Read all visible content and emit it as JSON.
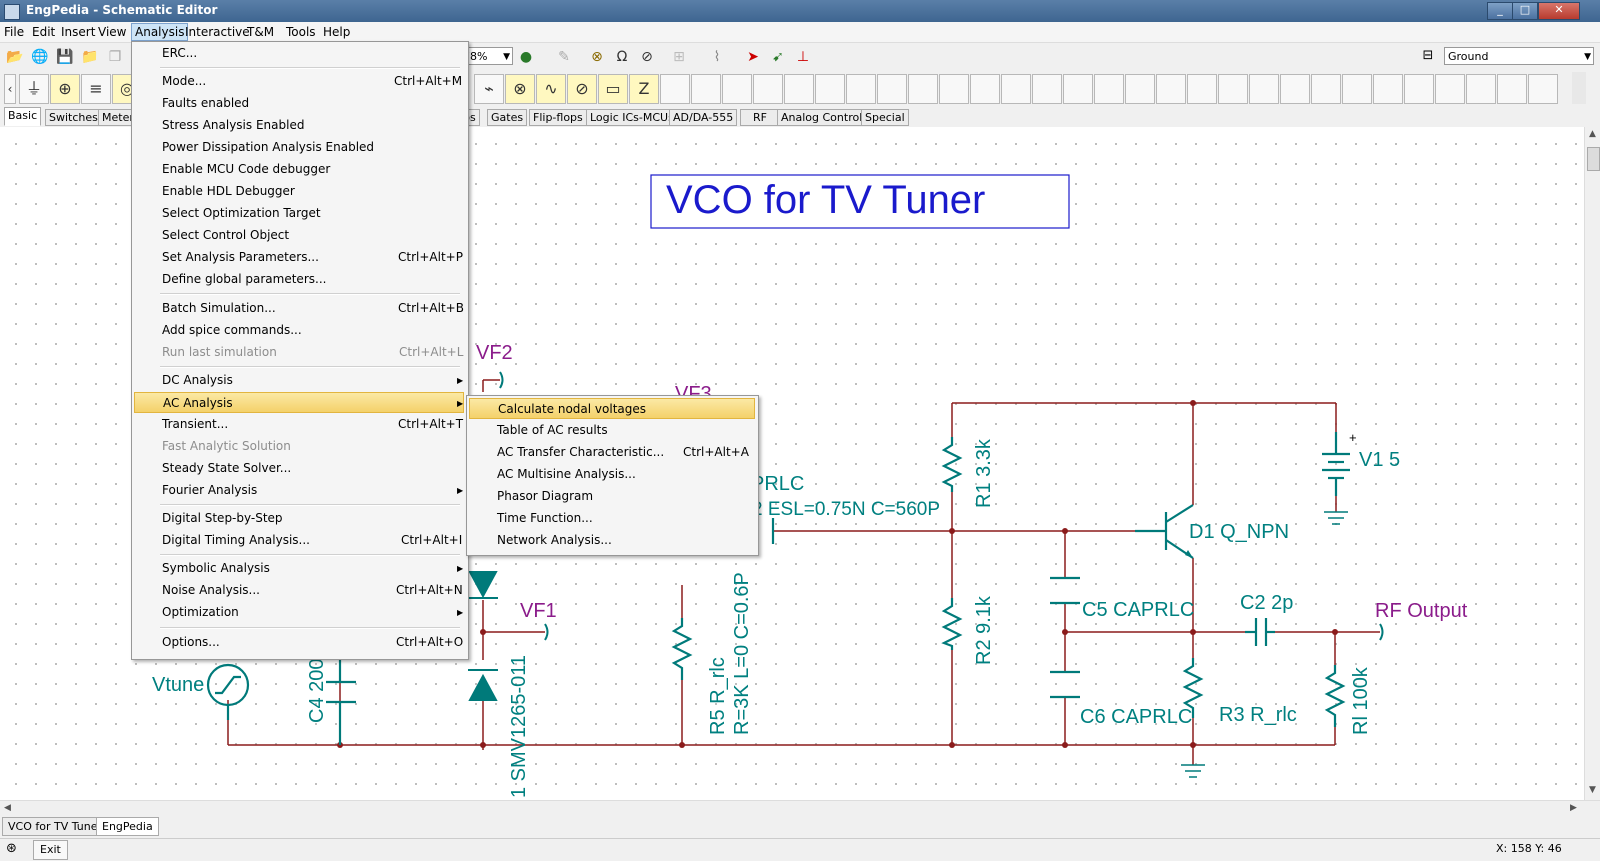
{
  "window": {
    "title": "EngPedia - Schematic Editor",
    "minimize": "_",
    "maximize": "□",
    "close": "✕"
  },
  "menubar": [
    "File",
    "Edit",
    "Insert",
    "View",
    "Analysis",
    "Interactive",
    "T&M",
    "Tools",
    "Help"
  ],
  "toolbar": {
    "zoom": "78%",
    "ground_select": "Ground"
  },
  "component_tabs": [
    "Basic",
    "Switches",
    "Meter",
    "ros",
    "Gates",
    "Flip-flops",
    "Logic ICs-MCUs",
    "AD/DA-555",
    "RF",
    "Analog Control",
    "Special"
  ],
  "analysis_menu": [
    {
      "label": "ERC...",
      "shortcut": ""
    },
    {
      "label": "Mode...",
      "shortcut": "Ctrl+Alt+M"
    },
    {
      "label": "Faults enabled",
      "shortcut": ""
    },
    {
      "label": "Stress Analysis Enabled",
      "shortcut": ""
    },
    {
      "label": "Power Dissipation Analysis Enabled",
      "shortcut": ""
    },
    {
      "label": "Enable MCU Code debugger",
      "shortcut": ""
    },
    {
      "label": "Enable HDL Debugger",
      "shortcut": ""
    },
    {
      "label": "Select Optimization Target",
      "shortcut": ""
    },
    {
      "label": "Select Control Object",
      "shortcut": ""
    },
    {
      "label": "Set Analysis Parameters...",
      "shortcut": "Ctrl+Alt+P"
    },
    {
      "label": "Define global parameters...",
      "shortcut": ""
    },
    {
      "label": "Batch Simulation...",
      "shortcut": "Ctrl+Alt+B"
    },
    {
      "label": "Add spice commands...",
      "shortcut": ""
    },
    {
      "label": "Run last simulation",
      "shortcut": "Ctrl+Alt+L",
      "disabled": true
    },
    {
      "label": "DC Analysis",
      "shortcut": ""
    },
    {
      "label": "AC Analysis",
      "shortcut": ""
    },
    {
      "label": "Transient...",
      "shortcut": "Ctrl+Alt+T"
    },
    {
      "label": "Fast Analytic Solution",
      "shortcut": "",
      "disabled": true
    },
    {
      "label": "Steady State Solver...",
      "shortcut": ""
    },
    {
      "label": "Fourier Analysis",
      "shortcut": ""
    },
    {
      "label": "Digital Step-by-Step",
      "shortcut": ""
    },
    {
      "label": "Digital Timing Analysis...",
      "shortcut": "Ctrl+Alt+I"
    },
    {
      "label": "Symbolic Analysis",
      "shortcut": ""
    },
    {
      "label": "Noise Analysis...",
      "shortcut": "Ctrl+Alt+N"
    },
    {
      "label": "Optimization",
      "shortcut": ""
    },
    {
      "label": "Options...",
      "shortcut": "Ctrl+Alt+O"
    }
  ],
  "ac_submenu": [
    {
      "label": "Calculate nodal voltages",
      "shortcut": ""
    },
    {
      "label": "Table of AC results",
      "shortcut": ""
    },
    {
      "label": "AC Transfer Characteristic...",
      "shortcut": "Ctrl+Alt+A"
    },
    {
      "label": "AC Multisine Analysis...",
      "shortcut": ""
    },
    {
      "label": "Phasor Diagram",
      "shortcut": ""
    },
    {
      "label": "Time Function...",
      "shortcut": ""
    },
    {
      "label": "Network Analysis...",
      "shortcut": ""
    }
  ],
  "schematic": {
    "title": "VCO for TV Tuner",
    "labels": {
      "vf2": "VF2",
      "vf3": "VF3",
      "vf1": "VF1",
      "vtune": "Vtune",
      "c4": "C4 200",
      "d_smv": "1 SMV1265-011",
      "caprlc": "PRLC",
      "esl": "2 ESL=0.75N C=560P",
      "r5a": "R5 R_rlc",
      "r5b": "R=3K L=0 C=0.6P",
      "r1": "R1 3.3k",
      "r2": "R2 9.1k",
      "q": "D1 Q_NPN",
      "v1": "V1 5",
      "plus": "+",
      "c5": "C5 CAPRLC",
      "c6": "C6 CAPRLC",
      "c2": "C2 2p",
      "r3": "R3 R_rlc",
      "rl": "Rl 100k",
      "rf": "RF Output"
    }
  },
  "doc_tabs": [
    "VCO for TV Tuner",
    "EngPedia"
  ],
  "status": {
    "exit": "Exit",
    "coords": "X: 158  Y: 46"
  },
  "colors": {
    "wire": "#8b1c1c",
    "component": "#007a7a",
    "label": "#008080",
    "node_label": "#8b1c8b",
    "title_text": "#1a1acc",
    "menu_highlight": "#f4d16a"
  }
}
